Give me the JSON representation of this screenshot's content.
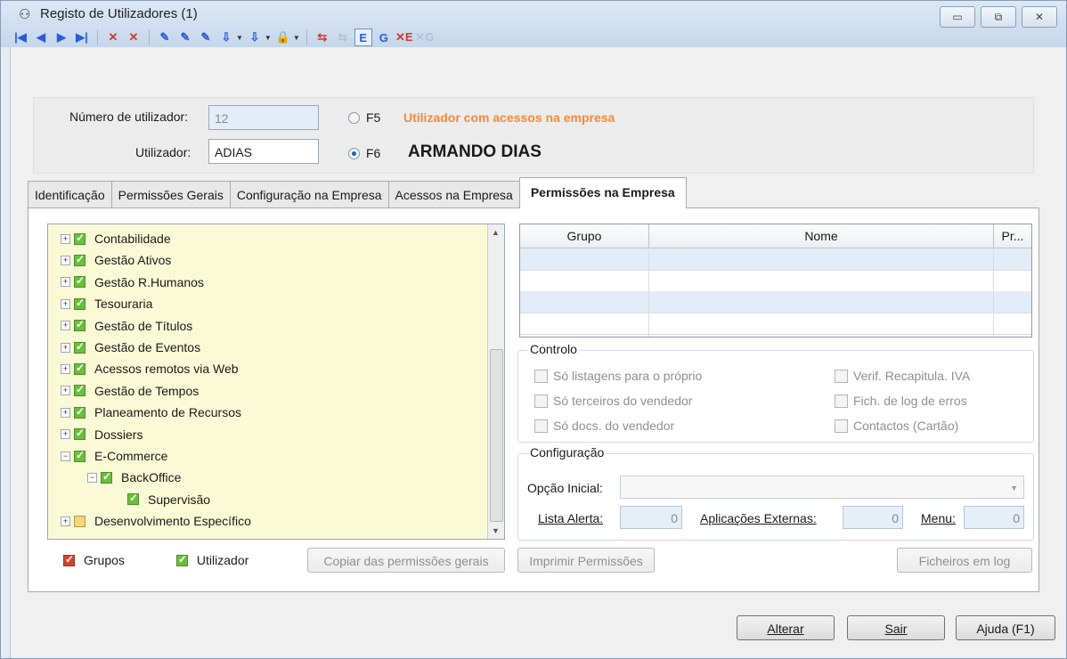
{
  "window": {
    "title": "Registo de Utilizadores (1)",
    "controls": [
      "▭",
      "⧉",
      "✕"
    ]
  },
  "toolbar": [
    "|◀",
    "◀",
    "▶",
    "▶|",
    "✕",
    "✕",
    "✎",
    "✎",
    "✎",
    "⇩",
    "⇩",
    "🔒",
    "⇆",
    "⇆",
    "E",
    "G",
    "✕E",
    "✕G"
  ],
  "header": {
    "numero_label": "Número de utilizador:",
    "numero_value": "12",
    "utilizador_label": "Utilizador:",
    "utilizador_value": "ADIAS",
    "f5_label": "F5",
    "f5_text": "Utilizador com acessos na empresa",
    "f6_label": "F6",
    "f6_text": "ARMANDO DIAS",
    "f5_color": "#f28a3a"
  },
  "tabs": [
    "Identificação",
    "Permissões Gerais",
    "Configuração na Empresa",
    "Acessos na Empresa",
    "Permissões na Empresa"
  ],
  "tree": [
    {
      "label": "Contabilidade",
      "level": 0,
      "exp": "+",
      "state": "on"
    },
    {
      "label": "Gestão Ativos",
      "level": 0,
      "exp": "+",
      "state": "on"
    },
    {
      "label": "Gestão R.Humanos",
      "level": 0,
      "exp": "+",
      "state": "on"
    },
    {
      "label": "Tesouraria",
      "level": 0,
      "exp": "+",
      "state": "on"
    },
    {
      "label": "Gestão de Títulos",
      "level": 0,
      "exp": "+",
      "state": "on"
    },
    {
      "label": "Gestão de Eventos",
      "level": 0,
      "exp": "+",
      "state": "on"
    },
    {
      "label": "Acessos remotos via Web",
      "level": 0,
      "exp": "+",
      "state": "on"
    },
    {
      "label": "Gestão de Tempos",
      "level": 0,
      "exp": "+",
      "state": "on"
    },
    {
      "label": "Planeamento de Recursos",
      "level": 0,
      "exp": "+",
      "state": "on"
    },
    {
      "label": "Dossiers",
      "level": 0,
      "exp": "+",
      "state": "on"
    },
    {
      "label": "E-Commerce",
      "level": 0,
      "exp": "−",
      "state": "on"
    },
    {
      "label": "BackOffice",
      "level": 1,
      "exp": "−",
      "state": "on"
    },
    {
      "label": "Supervisão",
      "level": 2,
      "exp": "",
      "state": "on"
    },
    {
      "label": "Desenvolvimento Específico",
      "level": 0,
      "exp": "+",
      "state": "partial"
    }
  ],
  "legend": {
    "grupos": "Grupos",
    "utilizador": "Utilizador"
  },
  "grid": {
    "headers": [
      "Grupo",
      "Nome",
      "Pr..."
    ]
  },
  "controlo": {
    "title": "Controlo",
    "items": [
      "Só listagens para o próprio",
      "Só terceiros do vendedor",
      "Só docs. do vendedor",
      "Verif. Recapitula. IVA",
      "Fich. de log de erros",
      "Contactos (Cartão)"
    ]
  },
  "configuracao": {
    "title": "Configuração",
    "opcao_label": "Opção Inicial:",
    "lista_label": "Lista Alerta:",
    "lista_value": "0",
    "apps_label": "Aplicações Externas:",
    "apps_value": "0",
    "menu_label": "Menu:",
    "menu_value": "0"
  },
  "buttons": {
    "copiar": "Copiar das permissões gerais",
    "imprimir": "Imprimir Permissões",
    "ficheiros": "Ficheiros em log",
    "alterar": "Alterar",
    "sair": "Sair",
    "ajuda": "Ajuda (F1)"
  }
}
